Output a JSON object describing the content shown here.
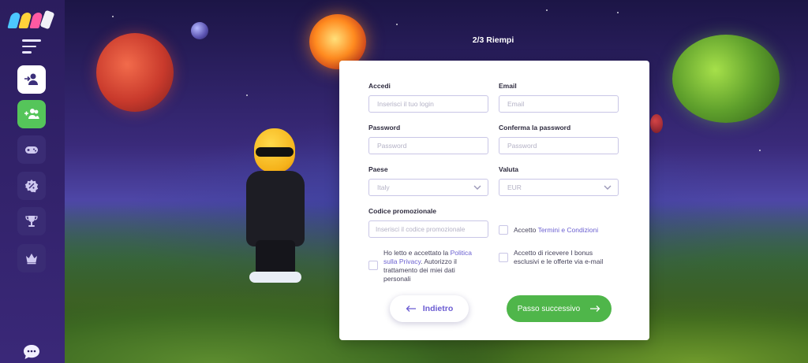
{
  "step": {
    "title": "2/3  Riempi"
  },
  "sidebar": {
    "items": [
      {
        "name": "login",
        "icon": "user-login-icon",
        "style": "white"
      },
      {
        "name": "register",
        "icon": "add-users-icon",
        "style": "green"
      },
      {
        "name": "games",
        "icon": "gamepad-icon",
        "style": "dark"
      },
      {
        "name": "bonus",
        "icon": "badge-percent-icon",
        "style": "dark"
      },
      {
        "name": "tournaments",
        "icon": "trophy-icon",
        "style": "dark"
      },
      {
        "name": "vip",
        "icon": "crown-icon",
        "style": "dark"
      }
    ]
  },
  "form": {
    "login": {
      "label": "Accedi",
      "placeholder": "Inserisci il tuo login"
    },
    "email": {
      "label": "Email",
      "placeholder": "Email"
    },
    "password": {
      "label": "Password",
      "placeholder": "Password"
    },
    "confirm_password": {
      "label": "Conferma la password",
      "placeholder": "Password"
    },
    "country": {
      "label": "Paese",
      "value": "Italy"
    },
    "currency": {
      "label": "Valuta",
      "value": "EUR"
    },
    "promo": {
      "label": "Codice promozionale",
      "placeholder": "Inserisci il codice promozionale"
    },
    "terms": {
      "prefix": "Accetto ",
      "link": "Termini e Condizioni",
      "checked": false
    },
    "privacy": {
      "prefix": "Ho letto e accettato la ",
      "link": "Politica sulla Privacy",
      "suffix": ". Autorizzo il trattamento dei miei dati personali",
      "checked": false
    },
    "offers": {
      "text": "Accetto di ricevere I bonus esclusivi e le offerte via e-mail",
      "checked": false
    }
  },
  "buttons": {
    "back": "Indietro",
    "next": "Passo successivo"
  },
  "colors": {
    "accent_green": "#4fb64a",
    "accent_purple": "#6b5cd2",
    "sidebar_bg": "#2b1d5e"
  }
}
